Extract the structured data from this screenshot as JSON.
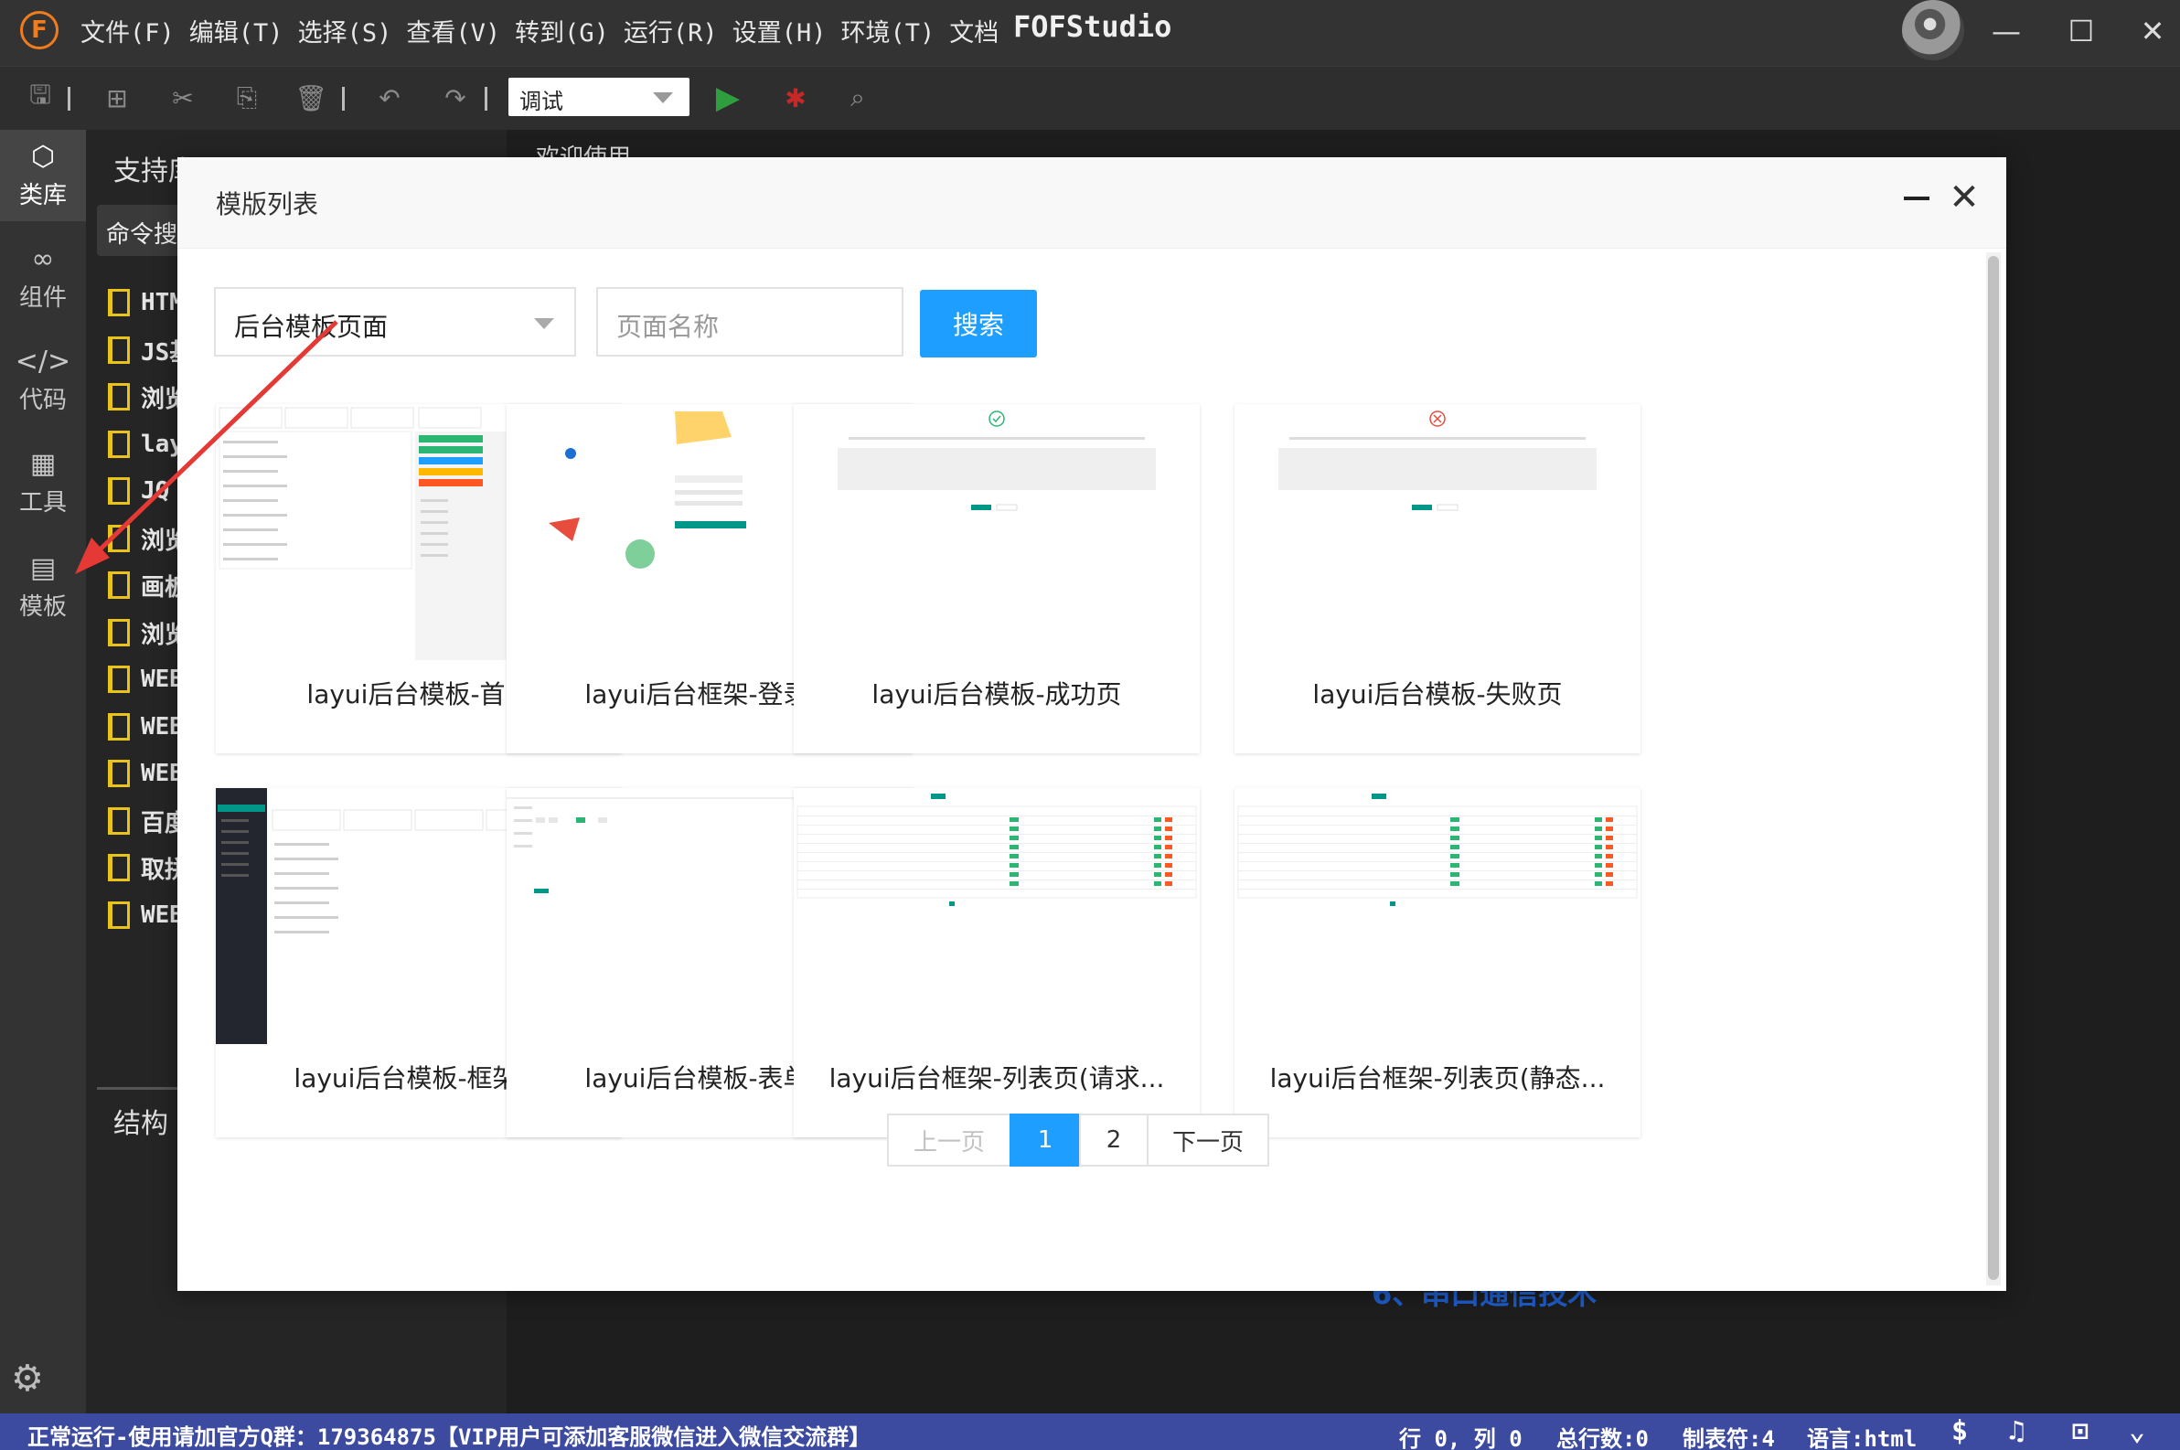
{
  "app": {
    "title": "FOFStudio",
    "logo_letter": "F",
    "menu": [
      "文件(F)",
      "编辑(T)",
      "选择(S)",
      "查看(V)",
      "转到(G)",
      "运行(R)",
      "设置(H)",
      "环境(T)",
      "文档"
    ]
  },
  "window_controls": {
    "minimize": "—",
    "maximize": "☐",
    "close": "✕"
  },
  "toolbar": {
    "run_mode": "调试"
  },
  "activity": [
    {
      "label": "类库",
      "icon": "cube-icon",
      "glyph": "⬡"
    },
    {
      "label": "组件",
      "icon": "link-icon",
      "glyph": "∞"
    },
    {
      "label": "代码",
      "icon": "code-icon",
      "glyph": "</>"
    },
    {
      "label": "工具",
      "icon": "grid-tools-icon",
      "glyph": "▦"
    },
    {
      "label": "模板",
      "icon": "template-book-icon",
      "glyph": "▤"
    }
  ],
  "sidebar": {
    "title": "支持库",
    "search": "命令搜索",
    "items": [
      "HTML",
      "JS基",
      "浏览",
      "layui",
      "JQ",
      "浏览",
      "画板",
      "浏览",
      "WEB",
      "WEB",
      "WEB",
      "百度",
      "取拼",
      "WEB"
    ],
    "structure": "结构"
  },
  "editor": {
    "tab": "欢迎使用",
    "footer_line": "6、串口通信技术"
  },
  "modal": {
    "title": "模版列表",
    "category_select": "后台模板页面",
    "name_placeholder": "页面名称",
    "search_button": "搜索",
    "cards": [
      {
        "label": "layui后台模板-首页"
      },
      {
        "label": "layui后台框架-登录页"
      },
      {
        "label": "layui后台模板-成功页"
      },
      {
        "label": "layui后台模板-失败页"
      },
      {
        "label": "layui后台模板-框架页"
      },
      {
        "label": "layui后台模板-表单页"
      },
      {
        "label": "layui后台框架-列表页(请求..."
      },
      {
        "label": "layui后台框架-列表页(静态..."
      }
    ],
    "pager": {
      "prev": "上一页",
      "pages": [
        "1",
        "2"
      ],
      "current": "1",
      "next": "下一页"
    }
  },
  "status": {
    "left": "正常运行-使用请加官方Q群：179364875【VIP用户可添加客服微信进入微信交流群】",
    "pos": "行 0, 列 0",
    "total": "总行数:0",
    "tab": "制表符:4",
    "lang": "语言:html"
  },
  "colors": {
    "accent": "#1e9fff",
    "status_bar": "#3c4aa0",
    "arrow": "#e53935",
    "layui_green": "#009688"
  }
}
